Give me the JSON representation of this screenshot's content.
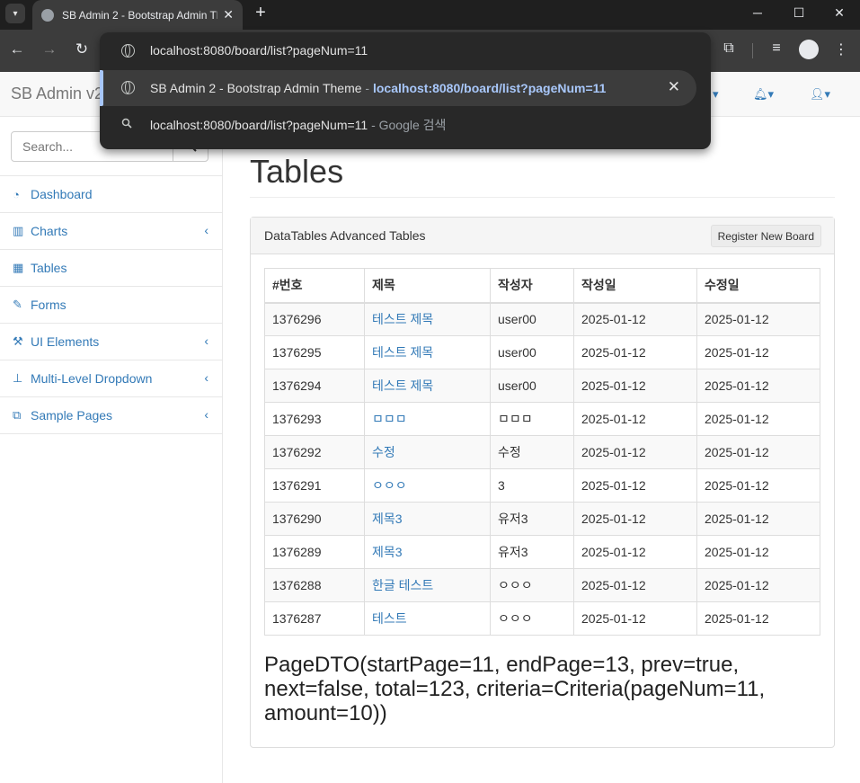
{
  "browser": {
    "tab_title": "SB Admin 2 - Bootstrap Admin Theme",
    "address": "localhost:8080/board/list?pageNum=11",
    "suggestion_title": "SB Admin 2 - Bootstrap Admin Theme",
    "suggestion_sep": " - ",
    "suggestion_url": "localhost:8080/board/list?pageNum=11",
    "search_query": "localhost:8080/board/list?pageNum=11",
    "search_suffix": " - Google 검색"
  },
  "app": {
    "brand": "SB Admin v2"
  },
  "sidebar": {
    "search_placeholder": "Search...",
    "items": [
      {
        "label": "Dashboard",
        "icon": "dashboard-icon",
        "has_arrow": false
      },
      {
        "label": "Charts",
        "icon": "bar-chart-icon",
        "has_arrow": true
      },
      {
        "label": "Tables",
        "icon": "table-icon",
        "has_arrow": false
      },
      {
        "label": "Forms",
        "icon": "edit-icon",
        "has_arrow": false
      },
      {
        "label": "UI Elements",
        "icon": "wrench-icon",
        "has_arrow": true
      },
      {
        "label": "Multi-Level Dropdown",
        "icon": "sitemap-icon",
        "has_arrow": true
      },
      {
        "label": "Sample Pages",
        "icon": "files-icon",
        "has_arrow": true
      }
    ]
  },
  "main": {
    "page_title": "Tables",
    "panel_title": "DataTables Advanced Tables",
    "register_button": "Register New Board",
    "table": {
      "headers": [
        "#번호",
        "제목",
        "작성자",
        "작성일",
        "수정일"
      ],
      "rows": [
        [
          "1376296",
          "테스트 제목",
          "user00",
          "2025-01-12",
          "2025-01-12"
        ],
        [
          "1376295",
          "테스트 제목",
          "user00",
          "2025-01-12",
          "2025-01-12"
        ],
        [
          "1376294",
          "테스트 제목",
          "user00",
          "2025-01-12",
          "2025-01-12"
        ],
        [
          "1376293",
          "ㅁㅁㅁ",
          "ㅁㅁㅁ",
          "2025-01-12",
          "2025-01-12"
        ],
        [
          "1376292",
          "수정",
          "수정",
          "2025-01-12",
          "2025-01-12"
        ],
        [
          "1376291",
          "ㅇㅇㅇ",
          "3",
          "2025-01-12",
          "2025-01-12"
        ],
        [
          "1376290",
          "제목3",
          "유저3",
          "2025-01-12",
          "2025-01-12"
        ],
        [
          "1376289",
          "제목3",
          "유저3",
          "2025-01-12",
          "2025-01-12"
        ],
        [
          "1376288",
          "한글 테스트",
          "ㅇㅇㅇ",
          "2025-01-12",
          "2025-01-12"
        ],
        [
          "1376287",
          "테스트",
          "ㅇㅇㅇ",
          "2025-01-12",
          "2025-01-12"
        ]
      ]
    },
    "page_dto": "PageDTO(startPage=11, endPage=13, prev=true, next=false, total=123, criteria=Criteria(pageNum=11, amount=10))"
  },
  "colors": {
    "link": "#337ab7",
    "chrome_dark": "#1f1f1f",
    "chrome_toolbar": "#3c3c3c",
    "omnibox_accent": "#a8c7fa"
  }
}
